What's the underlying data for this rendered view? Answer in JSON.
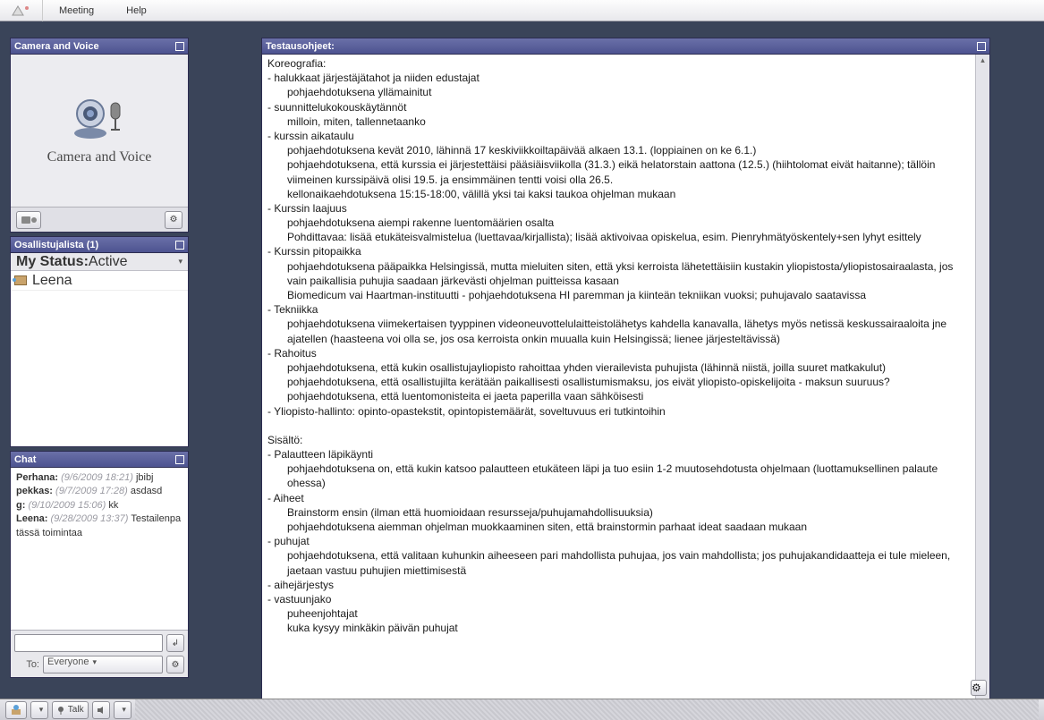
{
  "menubar": {
    "meeting": "Meeting",
    "help": "Help"
  },
  "camera_panel": {
    "title": "Camera and Voice",
    "body_label": "Camera and Voice",
    "cam_btn": "📹🎤",
    "gear": "⚙"
  },
  "participants_panel": {
    "title": "Osallistujalista (1)",
    "status_label": "My Status:",
    "status_value": "Active",
    "items": [
      {
        "name": "Leena"
      }
    ]
  },
  "chat_panel": {
    "title": "Chat",
    "lines": [
      {
        "user": "Perhana:",
        "ts": "(9/6/2009 18:21)",
        "msg": "jbibj"
      },
      {
        "user": "pekkas:",
        "ts": "(9/7/2009 17:28)",
        "msg": "asdasd"
      },
      {
        "user": "g:",
        "ts": "(9/10/2009 15:06)",
        "msg": "kk"
      },
      {
        "user": "Leena:",
        "ts": "(9/28/2009 13:37)",
        "msg": "Testailenpa tässä toimintaa"
      }
    ],
    "send_icon": "↲",
    "to_label": "To:",
    "to_value": "Everyone",
    "gear": "⚙"
  },
  "notes_panel": {
    "title": "Testausohjeet:",
    "lines": [
      "Koreografia:",
      "- halukkaat järjestäjätahot ja niiden edustajat",
      "      pohjaehdotuksena yllämainitut",
      "- suunnittelukokouskäytännöt",
      "      milloin, miten, tallennetaanko",
      "- kurssin aikataulu",
      "      pohjaehdotuksena kevät 2010, lähinnä 17 keskiviikkoiltapäivää alkaen 13.1. (loppiainen on ke 6.1.)",
      "      pohjaehdotuksena, että kurssia ei järjestettäisi pääsiäisviikolla (31.3.) eikä helatorstain aattona (12.5.) (hiihtolomat eivät haitanne); tällöin viimeinen kurssipäivä olisi 19.5. ja ensimmäinen tentti voisi olla 26.5.",
      "      kellonaikaehdotuksena 15:15-18:00, välillä yksi tai kaksi taukoa ohjelman mukaan",
      "- Kurssin laajuus",
      "      pohjaehdotuksena aiempi rakenne luentomäärien osalta",
      "      Pohdittavaa: lisää etukäteisvalmistelua (luettavaa/kirjallista); lisää aktivoivaa opiskelua, esim. Pienryhmätyöskentely+sen lyhyt esittely",
      "- Kurssin pitopaikka",
      "      pohjaehdotuksena pääpaikka Helsingissä, mutta mieluiten siten, että yksi kerroista lähetettäisiin kustakin yliopistosta/yliopistosairaalasta, jos vain paikallisia puhujia saadaan järkevästi ohjelman puitteissa kasaan",
      "      Biomedicum vai Haartman-instituutti - pohjaehdotuksena HI paremman ja kiinteän tekniikan vuoksi; puhujavalo saatavissa",
      "- Tekniikka",
      "      pohjaehdotuksena viimekertaisen tyyppinen videoneuvottelulaitteistolähetys kahdella kanavalla, lähetys myös netissä keskussairaaloita jne ajatellen (haasteena voi olla se, jos osa kerroista onkin muualla kuin Helsingissä; lienee järjesteltävissä)",
      "- Rahoitus",
      "      pohjaehdotuksena, että kukin osallistujayliopisto rahoittaa yhden vierailevista puhujista (lähinnä niistä, joilla suuret matkakulut)",
      "      pohjaehdotuksena, että osallistujilta kerätään paikallisesti osallistumismaksu, jos eivät yliopisto-opiskelijoita - maksun suuruus?",
      "      pohjaehdotuksena, että luentomonisteita ei jaeta paperilla vaan sähköisesti",
      "- Yliopisto-hallinto: opinto-opastekstit, opintopistemäärät, soveltuvuus eri tutkintoihin",
      "",
      "Sisältö:",
      "- Palautteen läpikäynti",
      "      pohjaehdotuksena on, että kukin katsoo palautteen etukäteen läpi ja tuo esiin 1-2 muutosehdotusta ohjelmaan (luottamuksellinen palaute ohessa)",
      "- Aiheet",
      "       Brainstorm ensin (ilman että huomioidaan resursseja/puhujamahdollisuuksia)",
      "      pohjaehdotuksena aiemman ohjelman muokkaaminen siten, että brainstormin parhaat ideat saadaan mukaan",
      "- puhujat",
      "      pohjaehdotuksena, että valitaan kuhunkin aiheeseen pari mahdollista puhujaa, jos vain mahdollista; jos puhujakandidaatteja ei tule mieleen, jaetaan vastuu puhujien miettimisestä",
      "- aihejärjestys",
      "- vastuunjako",
      "      puheenjohtajat",
      "      kuka kysyy minkäkin päivän puhujat"
    ]
  },
  "bottombar": {
    "talk": "Talk"
  }
}
